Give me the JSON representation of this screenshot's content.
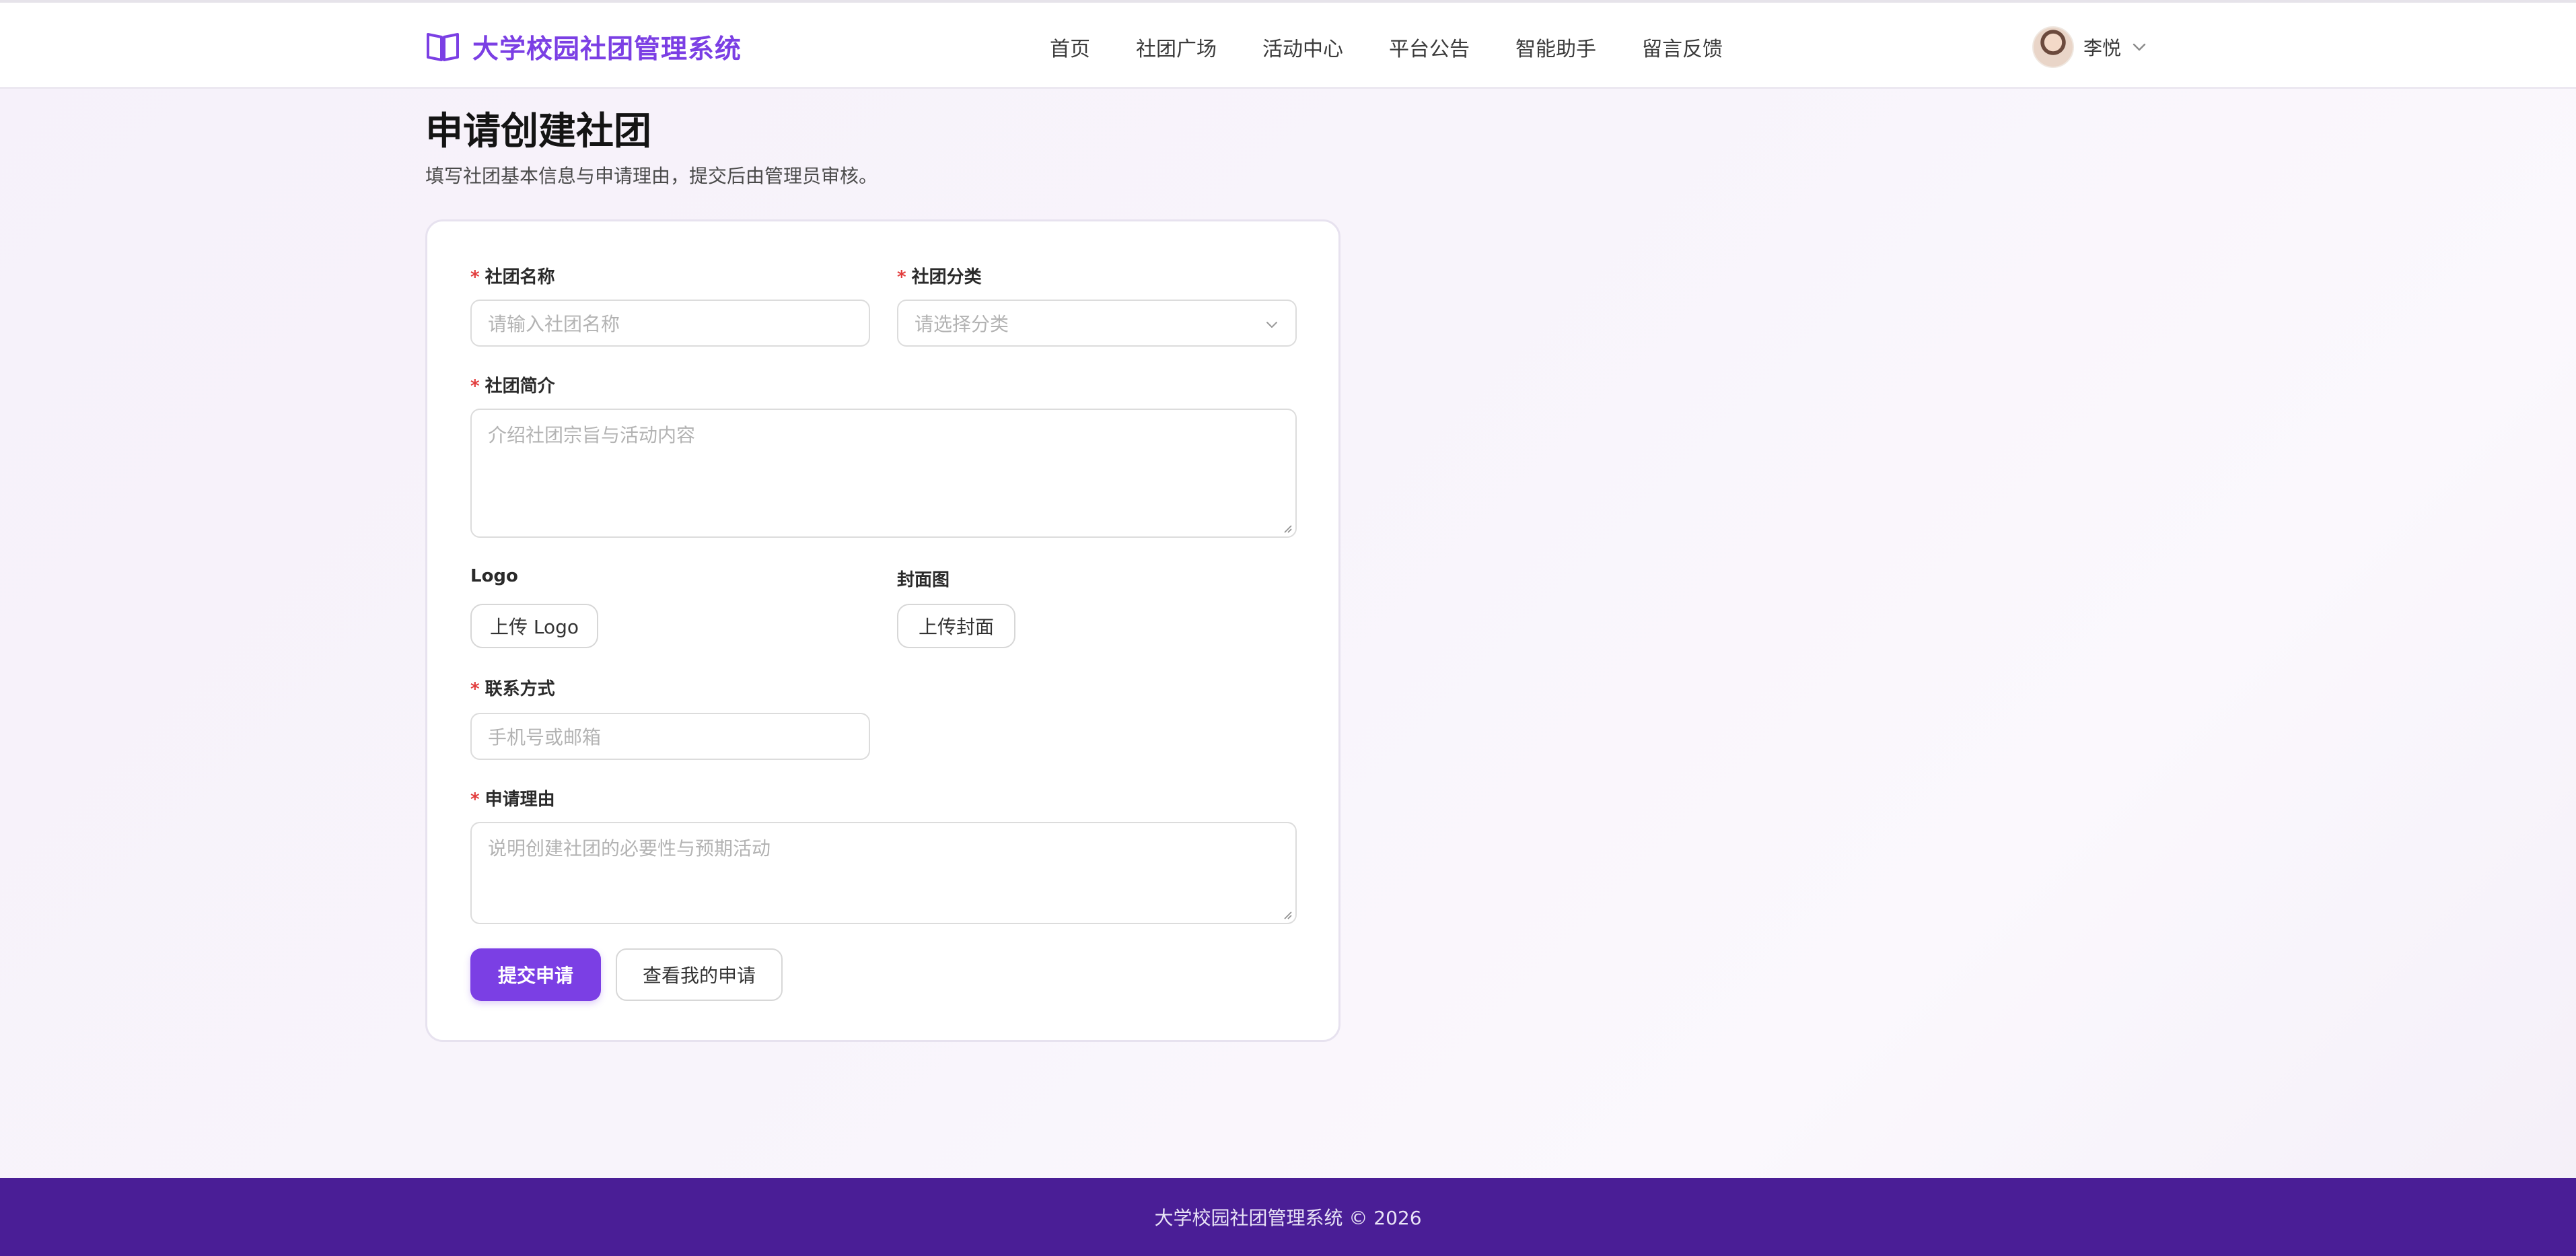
{
  "header": {
    "brand_title": "大学校园社团管理系统",
    "nav": [
      "首页",
      "社团广场",
      "活动中心",
      "平台公告",
      "智能助手",
      "留言反馈"
    ],
    "user_name": "李悦"
  },
  "page": {
    "title": "申请创建社团",
    "description": "填写社团基本信息与申请理由，提交后由管理员审核。"
  },
  "form": {
    "club_name": {
      "label": "社团名称",
      "placeholder": "请输入社团名称"
    },
    "category": {
      "label": "社团分类",
      "placeholder": "请选择分类"
    },
    "intro": {
      "label": "社团简介",
      "placeholder": "介绍社团宗旨与活动内容"
    },
    "logo": {
      "label": "Logo",
      "button": "上传 Logo"
    },
    "cover": {
      "label": "封面图",
      "button": "上传封面"
    },
    "contact": {
      "label": "联系方式",
      "placeholder": "手机号或邮箱"
    },
    "reason": {
      "label": "申请理由",
      "placeholder": "说明创建社团的必要性与预期活动"
    },
    "required_mark": "*",
    "submit_label": "提交申请",
    "view_label": "查看我的申请"
  },
  "footer": {
    "text": "大学校园社团管理系统 © 2026"
  },
  "colors": {
    "accent": "#7b3fe4",
    "footer_bg": "#4a1e96",
    "required": "#e23c3c"
  },
  "icons": {
    "brand": "open-book-icon",
    "user_menu": "chevron-down-icon",
    "select": "chevron-down-icon"
  }
}
